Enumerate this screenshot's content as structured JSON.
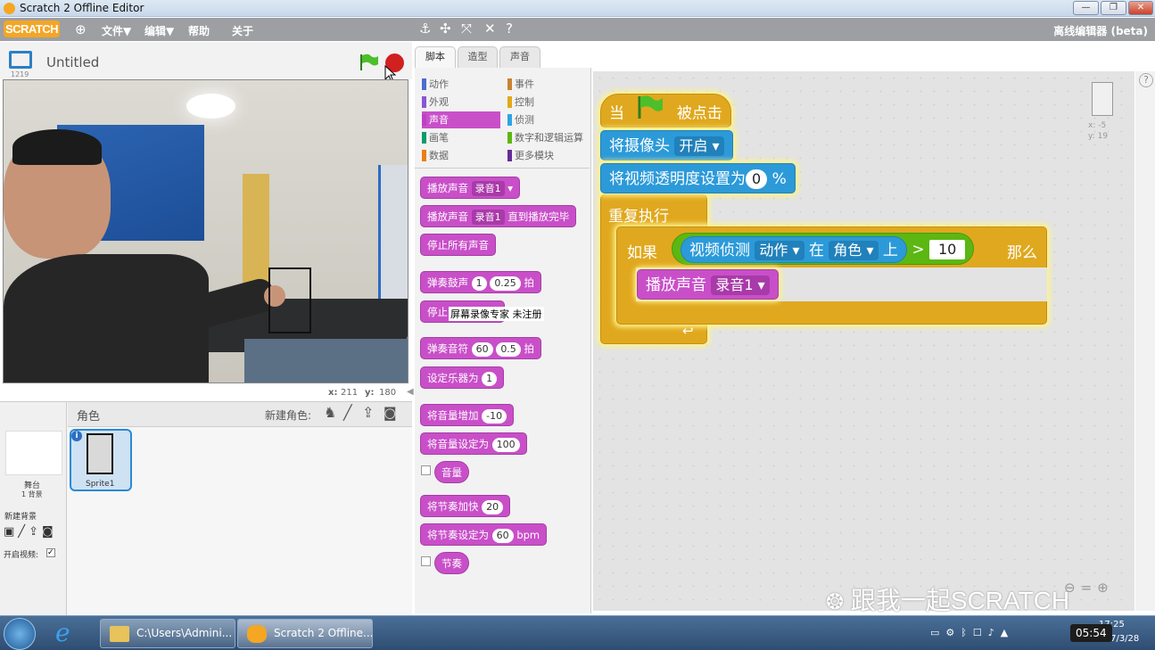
{
  "window": {
    "title": "Scratch 2 Offline Editor",
    "minimize": "—",
    "maximize": "❐",
    "close": "✕"
  },
  "menubar": {
    "logo": "SCRATCH",
    "menus": [
      "文件▼",
      "编辑▼",
      "帮助",
      "关于"
    ],
    "offline_label": "离线编辑器 (beta)"
  },
  "stage": {
    "title": "Untitled",
    "version": "1219",
    "mouse_x_label": "x:",
    "mouse_x": "211",
    "mouse_y_label": "y:",
    "mouse_y": "180"
  },
  "sprites": {
    "header": "角色",
    "new_sprite_label": "新建角色:",
    "stage_label": "舞台",
    "stage_backdrops": "1 背景",
    "new_backdrop_label": "新建背景",
    "video_label": "开启视频:",
    "sprite_name": "Sprite1"
  },
  "tabs": [
    "脚本",
    "造型",
    "声音"
  ],
  "categories": {
    "left": [
      "动作",
      "外观",
      "声音",
      "画笔",
      "数据"
    ],
    "right": [
      "事件",
      "控制",
      "侦测",
      "数字和逻辑运算",
      "更多模块"
    ],
    "colors_left": [
      "#4a6cd4",
      "#8a55d7",
      "#bb42c3",
      "#0e9a6c",
      "#ee7d16"
    ],
    "colors_right": [
      "#c88330",
      "#e1a91a",
      "#2ca5e2",
      "#5cb712",
      "#632d99"
    ],
    "selected": "声音"
  },
  "palette": {
    "play_sound": "播放声音",
    "play_sound_arg": "录音1",
    "play_sound_until": "播放声音",
    "play_sound_until_arg": "录音1",
    "play_sound_until_suffix": "直到播放完毕",
    "stop_all": "停止所有声音",
    "play_drum": "弹奏鼓声",
    "play_drum_arg1": "1",
    "play_drum_arg2": "0.25",
    "play_drum_suffix": "拍",
    "rest": "停止",
    "watermark": "屏幕录像专家 未注册",
    "play_note": "弹奏音符",
    "play_note_arg1": "60",
    "play_note_arg2": "0.5",
    "play_note_suffix": "拍",
    "set_instrument": "设定乐器为",
    "set_instrument_arg": "1",
    "change_volume": "将音量增加",
    "change_volume_arg": "-10",
    "set_volume": "将音量设定为",
    "set_volume_arg": "100",
    "volume_reporter": "音量",
    "change_tempo": "将节奏加快",
    "change_tempo_arg": "20",
    "set_tempo": "将节奏设定为",
    "set_tempo_arg": "60",
    "set_tempo_unit": "bpm",
    "tempo_reporter": "节奏"
  },
  "script": {
    "hat_prefix": "当",
    "hat_suffix": "被点击",
    "camera": "将摄像头",
    "camera_arg": "开启",
    "transparency": "将视频透明度设置为",
    "transparency_arg": "0",
    "transparency_unit": "%",
    "forever": "重复执行",
    "if_label": "如果",
    "then_label": "那么",
    "video_sensing": "视频侦测",
    "sensing_attr": "动作",
    "on_label": "在",
    "sensing_target": "角色",
    "above_label": "上",
    "gt": ">",
    "threshold": "10",
    "play_sound": "播放声音",
    "play_sound_arg": "录音1",
    "loop_arrow": "↩"
  },
  "sprite_info": {
    "x_label": "x:",
    "x": "-5",
    "y_label": "y:",
    "y": "19"
  },
  "overlay_watermark": "跟我一起SCRATCH",
  "taskbar": {
    "explorer_title": "C:\\Users\\Admini...",
    "scratch_title": "Scratch 2 Offline...",
    "time_badge": "05:54",
    "clock_time": "17:25",
    "clock_date": "2017/3/28"
  }
}
